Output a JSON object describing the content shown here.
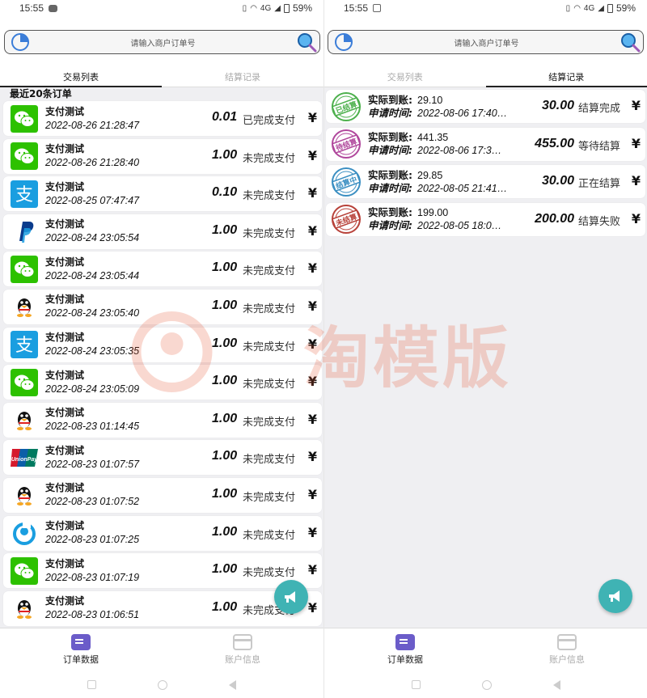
{
  "left": {
    "status": {
      "time": "15:55",
      "net": "4G",
      "battery": "59%"
    },
    "search": {
      "placeholder": "请输入商户订单号"
    },
    "tabs": [
      {
        "label": "交易列表",
        "active": true
      },
      {
        "label": "结算记录",
        "active": false
      }
    ],
    "section_title": "最近20条订单",
    "orders": [
      {
        "icon": "wechat-icon",
        "name": "支付测试",
        "time": "2022-08-26 21:28:47",
        "amount": "0.01",
        "status": "已完成支付",
        "currency": "¥"
      },
      {
        "icon": "wechat-icon",
        "name": "支付测试",
        "time": "2022-08-26 21:28:40",
        "amount": "1.00",
        "status": "未完成支付",
        "currency": "¥"
      },
      {
        "icon": "alipay-icon",
        "name": "支付测试",
        "time": "2022-08-25 07:47:47",
        "amount": "0.10",
        "status": "未完成支付",
        "currency": "¥"
      },
      {
        "icon": "paypal-icon",
        "name": "支付测试",
        "time": "2022-08-24 23:05:54",
        "amount": "1.00",
        "status": "未完成支付",
        "currency": "¥"
      },
      {
        "icon": "wechat-icon",
        "name": "支付测试",
        "time": "2022-08-24 23:05:44",
        "amount": "1.00",
        "status": "未完成支付",
        "currency": "¥"
      },
      {
        "icon": "qq-icon",
        "name": "支付测试",
        "time": "2022-08-24 23:05:40",
        "amount": "1.00",
        "status": "未完成支付",
        "currency": "¥"
      },
      {
        "icon": "alipay-icon",
        "name": "支付测试",
        "time": "2022-08-24 23:05:35",
        "amount": "1.00",
        "status": "未完成支付",
        "currency": "¥"
      },
      {
        "icon": "wechat-icon",
        "name": "支付测试",
        "time": "2022-08-24 23:05:09",
        "amount": "1.00",
        "status": "未完成支付",
        "currency": "¥"
      },
      {
        "icon": "qq-icon",
        "name": "支付测试",
        "time": "2022-08-23 01:14:45",
        "amount": "1.00",
        "status": "未完成支付",
        "currency": "¥"
      },
      {
        "icon": "unionpay-icon",
        "name": "支付测试",
        "time": "2022-08-23 01:07:57",
        "amount": "1.00",
        "status": "未完成支付",
        "currency": "¥"
      },
      {
        "icon": "qq-icon",
        "name": "支付测试",
        "time": "2022-08-23 01:07:52",
        "amount": "1.00",
        "status": "未完成支付",
        "currency": "¥"
      },
      {
        "icon": "droplet-icon",
        "name": "支付测试",
        "time": "2022-08-23 01:07:25",
        "amount": "1.00",
        "status": "未完成支付",
        "currency": "¥"
      },
      {
        "icon": "wechat-icon",
        "name": "支付测试",
        "time": "2022-08-23 01:07:19",
        "amount": "1.00",
        "status": "未完成支付",
        "currency": "¥"
      },
      {
        "icon": "qq-icon",
        "name": "支付测试",
        "time": "2022-08-23 01:06:51",
        "amount": "1.00",
        "status": "未完成支付",
        "currency": "¥"
      }
    ],
    "nav": [
      {
        "label": "订单数据",
        "active": true
      },
      {
        "label": "账户信息",
        "active": false
      }
    ]
  },
  "right": {
    "status": {
      "time": "15:55",
      "net": "4G",
      "battery": "59%"
    },
    "search": {
      "placeholder": "请输入商户订单号"
    },
    "tabs": [
      {
        "label": "交易列表",
        "active": false
      },
      {
        "label": "结算记录",
        "active": true
      }
    ],
    "settlements": [
      {
        "stamp": "已结算",
        "stamp_color": "#4cb04c",
        "actual_label": "实际到账:",
        "actual": "29.10",
        "time_label": "申请时间:",
        "time": "2022-08-06 17:40…",
        "amount": "30.00",
        "status": "结算完成",
        "currency": "¥"
      },
      {
        "stamp": "待结算",
        "stamp_color": "#b0479c",
        "actual_label": "实际到账:",
        "actual": "441.35",
        "time_label": "申请时间:",
        "time": "2022-08-06 17:3…",
        "amount": "455.00",
        "status": "等待结算",
        "currency": "¥"
      },
      {
        "stamp": "结算中",
        "stamp_color": "#3b8fc2",
        "actual_label": "实际到账:",
        "actual": "29.85",
        "time_label": "申请时间:",
        "time": "2022-08-05 21:41…",
        "amount": "30.00",
        "status": "正在结算",
        "currency": "¥"
      },
      {
        "stamp": "未结算",
        "stamp_color": "#b8423a",
        "actual_label": "实际到账:",
        "actual": "199.00",
        "time_label": "申请时间:",
        "time": "2022-08-05 18:0…",
        "amount": "200.00",
        "status": "结算失败",
        "currency": "¥"
      }
    ],
    "nav": [
      {
        "label": "订单数据",
        "active": true
      },
      {
        "label": "账户信息",
        "active": false
      }
    ]
  },
  "watermark": {
    "text": "淘模版"
  },
  "colors": {
    "wechat": "#2dc100",
    "alipay": "#1a9ee0",
    "paypal": "#0a3b8c",
    "unionpay_red": "#d5192c",
    "unionpay_blue": "#0b5ea8",
    "unionpay_green": "#007a60",
    "fab": "#3fb3b4",
    "nav_active": "#6b5cc9",
    "watermark": "#e8502c"
  }
}
